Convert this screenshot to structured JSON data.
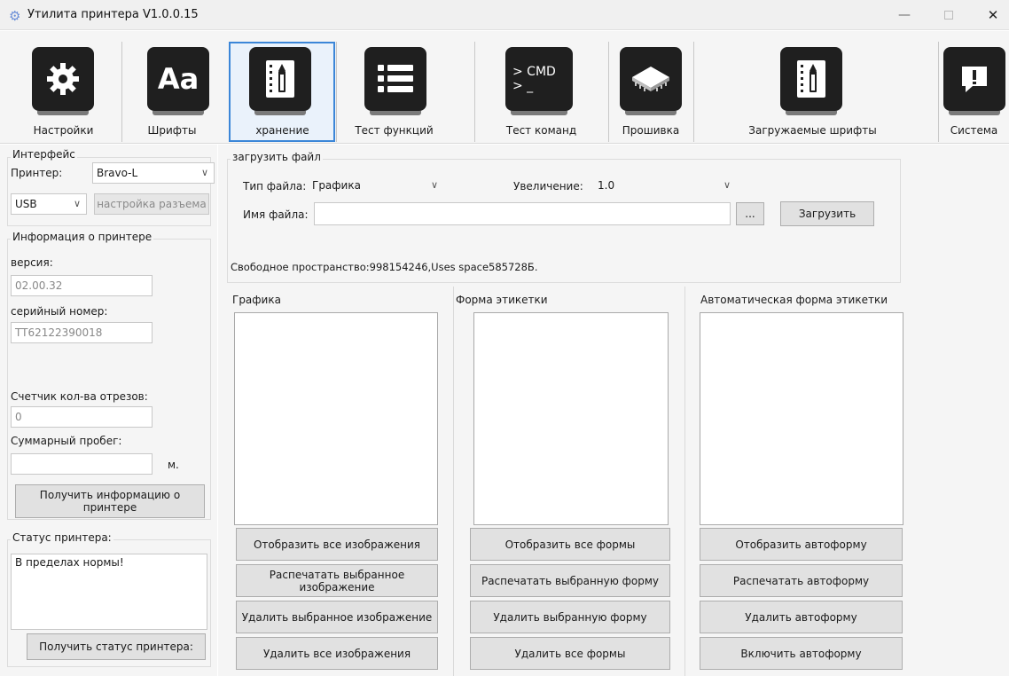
{
  "window": {
    "title": "Утилита принтера  V1.0.0.15",
    "minimize": "—",
    "close": "✕"
  },
  "toolbar": {
    "items": [
      {
        "label": "Настройки",
        "icon": "gear-icon"
      },
      {
        "label": "Шрифты",
        "icon": "font-icon",
        "glyph": "Aa"
      },
      {
        "label": "хранение",
        "icon": "storage-icon"
      },
      {
        "label": "Тест функций",
        "icon": "list-icon"
      },
      {
        "label": "Тест команд",
        "icon": "cmd-icon",
        "glyph": "> CMD\n> _"
      },
      {
        "label": "Прошивка",
        "icon": "chip-icon"
      },
      {
        "label": "Загружаемые шрифты",
        "icon": "storage-icon"
      },
      {
        "label": "Система",
        "icon": "alert-icon"
      }
    ],
    "active_index": 2
  },
  "left": {
    "interface": {
      "title": "Интерфейс",
      "printer_label": "Принтер:",
      "printer_value": "Bravo-L",
      "port_value": "USB",
      "port_settings": "настройка разъема"
    },
    "info": {
      "title": "Информация о принтере",
      "version_label": "версия:",
      "version_value": "02.00.32",
      "serial_label": "серийный номер:",
      "serial_value": "TT62122390018",
      "cut_label": "Счетчик кол-ва отрезов:",
      "cut_value": "0",
      "mileage_label": "Суммарный пробег:",
      "mileage_value": "",
      "mileage_unit": "м.",
      "get_info_button": "Получить информацию о принтере"
    },
    "status": {
      "title": "Статус принтера:",
      "value": "В пределах нормы!",
      "get_status_button": "Получить статус принтера:"
    }
  },
  "upload": {
    "title": "загрузить файл",
    "file_type_label": "Тип файла:",
    "file_type_value": "Графика",
    "zoom_label": "Увеличение:",
    "zoom_value": "1.0",
    "file_name_label": "Имя файла:",
    "file_name_value": "",
    "browse_button": "...",
    "load_button": "Загрузить",
    "free_space": "Свободное пространство:998154246,Uses space585728Б."
  },
  "columns": [
    {
      "title": "Графика",
      "buttons": [
        "Отобразить все изображения",
        "Распечатать выбранное изображение",
        "Удалить выбранное изображение",
        "Удалить все изображения"
      ]
    },
    {
      "title": "Форма этикетки",
      "buttons": [
        "Отобразить все формы",
        "Распечатать выбранную форму",
        "Удалить выбранную форму",
        "Удалить все формы"
      ]
    },
    {
      "title": "Автоматическая форма этикетки",
      "buttons": [
        "Отобразить автоформу",
        "Распечатать автоформу",
        "Удалить автоформу",
        "Включить автоформу"
      ]
    }
  ]
}
